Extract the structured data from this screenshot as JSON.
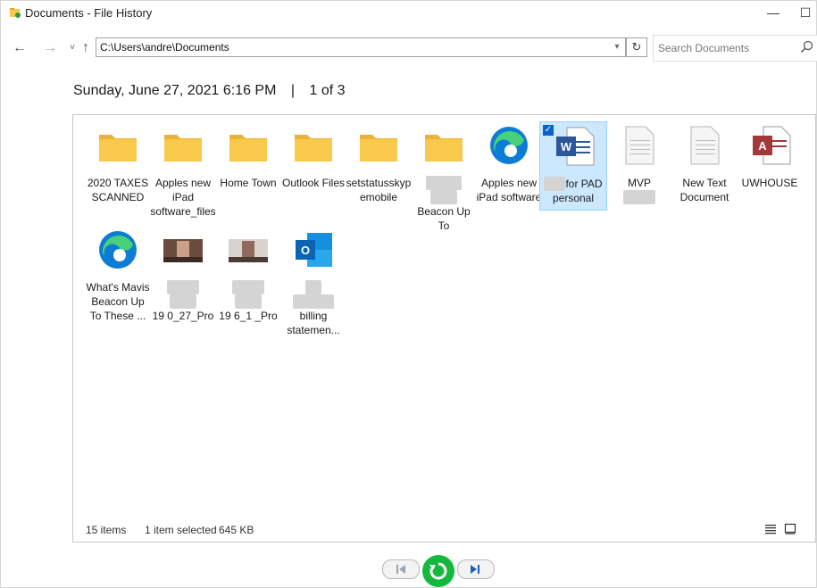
{
  "window": {
    "title": "Documents - File History",
    "minimize_glyph": "—",
    "maximize_glyph": "☐"
  },
  "nav": {
    "back_glyph": "←",
    "forward_glyph": "→",
    "recent_glyph": "˅",
    "up_glyph": "↑",
    "address": "C:\\Users\\andre\\Documents",
    "refresh_glyph": "↻",
    "search_placeholder": "Search Documents"
  },
  "header": {
    "date": "Sunday, June 27, 2021 6:16 PM",
    "separator": "|",
    "version": "1 of 3"
  },
  "items": [
    {
      "label": "2020 TAXES SCANNED",
      "icon": "folder-icon"
    },
    {
      "label": "Apples new iPad software_files",
      "icon": "folder-icon"
    },
    {
      "label": "Home Town",
      "icon": "folder-icon"
    },
    {
      "label": "Outlook Files",
      "icon": "folder-icon"
    },
    {
      "label": "setstatusskypemobile",
      "icon": "folder-icon"
    },
    {
      "label": "Beacon Up To",
      "icon": "folder-icon"
    },
    {
      "label": "Apples new iPad software",
      "icon": "edge-icon"
    },
    {
      "label": "for PAD personal",
      "icon": "word-doc-icon"
    },
    {
      "label": "MVP",
      "icon": "text-file-icon"
    },
    {
      "label": "New Text Document",
      "icon": "text-file-icon"
    },
    {
      "label": "UWHOUSE",
      "icon": "access-icon"
    },
    {
      "label": "What's Mavis Beacon Up To These ...",
      "icon": "edge-icon"
    },
    {
      "label": "19 0_27_Pro",
      "icon": "video-thumb-icon"
    },
    {
      "label": "19 6_1 _Pro",
      "icon": "video-thumb-icon"
    },
    {
      "label": "billing statemen...",
      "icon": "outlook-icon"
    }
  ],
  "status": {
    "count": "15 items",
    "selection": "1 item selected",
    "size": "645 KB"
  },
  "colors": {
    "folder": "#f8c94a",
    "selected_bg": "#cce8ff",
    "restore_green": "#14b83d",
    "word_blue": "#2b579a",
    "access_red": "#a4373a",
    "edge_blue": "#0c7cd5"
  }
}
